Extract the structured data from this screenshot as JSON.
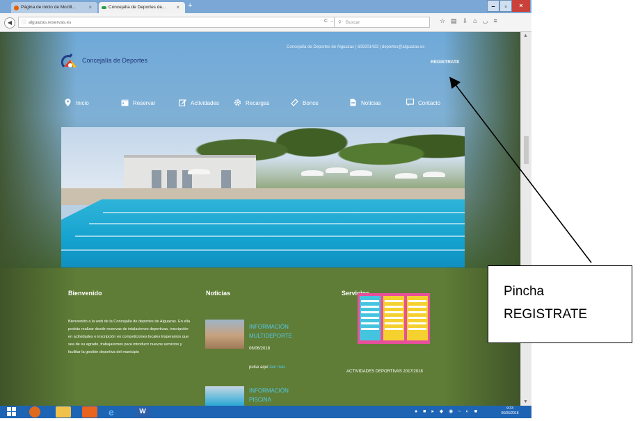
{
  "browser": {
    "tabs": [
      {
        "label": "Página de inicio de Mozill...",
        "active": false
      },
      {
        "label": "Concejalía de Deportes de...",
        "active": true
      }
    ],
    "new_tab": "+",
    "url": "alguazas.reservas.es",
    "search_placeholder": "Buscar",
    "window_buttons": {
      "minimize": "–",
      "maximize": "▫",
      "close": "×"
    }
  },
  "site": {
    "logo_text": "Concejalía de Deportes",
    "contact_line": "Concejalía de Deportes de Alguazas | 609201423 | deportes@alguazas.es",
    "register": "REGISTRATE",
    "menu": [
      {
        "label": "Inicio",
        "icon": "location-pin-icon"
      },
      {
        "label": "Reservar",
        "icon": "calendar-icon"
      },
      {
        "label": "Actividades",
        "icon": "edit-icon"
      },
      {
        "label": "Recargas",
        "icon": "gear-icon"
      },
      {
        "label": "Bonos",
        "icon": "ticket-icon"
      },
      {
        "label": "Noticias",
        "icon": "document-icon"
      },
      {
        "label": "Contacto",
        "icon": "chat-icon"
      }
    ],
    "welcome": {
      "title": "Bienvenido",
      "text": "Bienvenido a la web de la Concejalía de deportes de Alguazas. En ella podrás realizar desde reservas de intalaciones deportivas, inscripción en actividades e inscripción en competiciones locales Esperamos que sea de su agrado, trabajaremos para introducir nuevos servicios y facilitar la gestión deportiva del municipio"
    },
    "news": {
      "title": "Noticias",
      "items": [
        {
          "title_line1": "INFORMACIÓN",
          "title_line2": "MULTIDEPORTE",
          "date": "06/06/2018",
          "text": "pulse aquí",
          "link": "leer más"
        },
        {
          "title_line1": "INFORMACIÓN",
          "title_line2": "PISCINA"
        }
      ]
    },
    "services": {
      "title": "Servicios",
      "caption": "ACTIVIDADES DEPORTIVAS 2017/2018"
    }
  },
  "taskbar": {
    "clock_time": "9:33",
    "clock_date": "06/06/2018"
  },
  "callout": {
    "line1": "Pincha",
    "line2": "REGISTRATE"
  },
  "colors": {
    "menu_text": "#ffffff",
    "news_title": "#56c8e8",
    "services_bg": "#e84f9b",
    "taskbar": "#1d64b4"
  }
}
